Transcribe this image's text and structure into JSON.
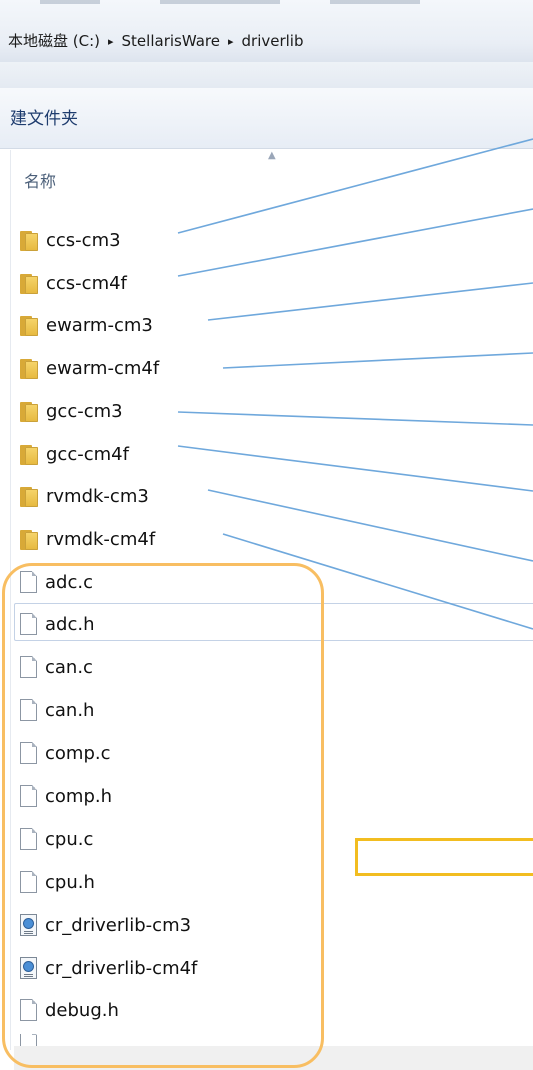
{
  "breadcrumb": {
    "items": [
      "本地磁盘 (C:)",
      "StellarisWare",
      "driverlib"
    ],
    "separator": "▸"
  },
  "toolbar": {
    "new_folder_label": "建文件夹"
  },
  "columns": {
    "name_label": "名称"
  },
  "folders": [
    {
      "label": "ccs-cm3",
      "icon": "folder-icon"
    },
    {
      "label": "ccs-cm4f",
      "icon": "folder-icon"
    },
    {
      "label": "ewarm-cm3",
      "icon": "folder-icon"
    },
    {
      "label": "ewarm-cm4f",
      "icon": "folder-icon"
    },
    {
      "label": "gcc-cm3",
      "icon": "folder-icon"
    },
    {
      "label": "gcc-cm4f",
      "icon": "folder-icon"
    },
    {
      "label": "rvmdk-cm3",
      "icon": "folder-icon"
    },
    {
      "label": "rvmdk-cm4f",
      "icon": "folder-icon"
    }
  ],
  "files": [
    {
      "label": "adc.c",
      "icon": "file-icon"
    },
    {
      "label": "adc.h",
      "icon": "file-icon",
      "selected": true
    },
    {
      "label": "can.c",
      "icon": "file-icon"
    },
    {
      "label": "can.h",
      "icon": "file-icon"
    },
    {
      "label": "comp.c",
      "icon": "file-icon"
    },
    {
      "label": "comp.h",
      "icon": "file-icon"
    },
    {
      "label": "cpu.c",
      "icon": "file-icon"
    },
    {
      "label": "cpu.h",
      "icon": "file-icon"
    },
    {
      "label": "cr_driverlib-cm3",
      "icon": "project-file-icon"
    },
    {
      "label": "cr_driverlib-cm4f",
      "icon": "project-file-icon"
    },
    {
      "label": "debug.h",
      "icon": "file-icon"
    }
  ],
  "colors": {
    "annotation_line": "#6fa8dc",
    "annotation_orange": "#f8be62",
    "annotation_yellow": "#f2bd20",
    "folder": "#e6b83e"
  }
}
